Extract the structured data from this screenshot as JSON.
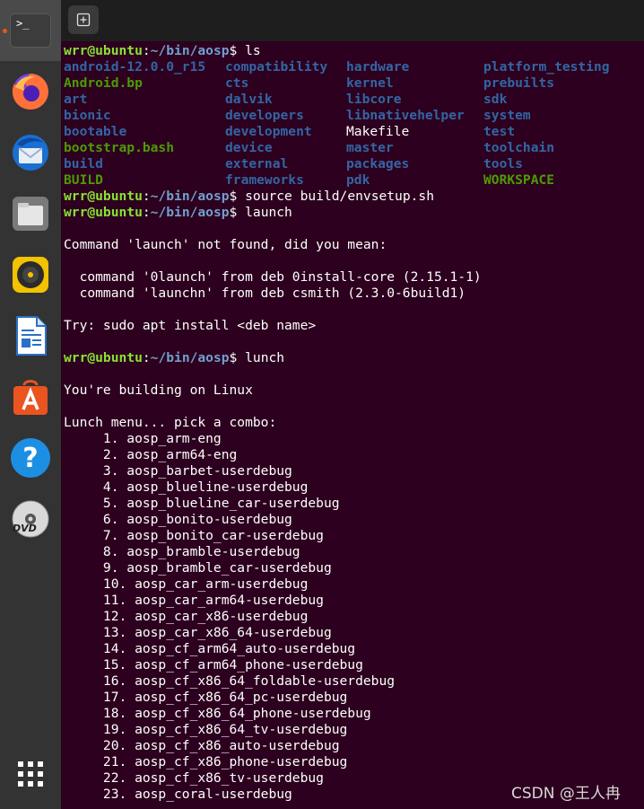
{
  "dock": {
    "items": [
      {
        "name": "terminal",
        "active": true
      },
      {
        "name": "firefox"
      },
      {
        "name": "thunderbird"
      },
      {
        "name": "files"
      },
      {
        "name": "rhythmbox"
      },
      {
        "name": "libreoffice-writer"
      },
      {
        "name": "ubuntu-software"
      },
      {
        "name": "help"
      },
      {
        "name": "dvd"
      },
      {
        "name": "show-applications"
      }
    ],
    "terminal_glyph": ">_",
    "dvd_label": "DVD",
    "help_glyph": "?"
  },
  "tabbar": {
    "new_tab_icon": "new-tab-icon"
  },
  "prompt": {
    "user_host": "wrr@ubuntu",
    "sep": ":",
    "path": "~/bin/aosp",
    "dollar": "$ "
  },
  "commands": {
    "ls": "ls",
    "source": "source build/envsetup.sh",
    "launch": "launch",
    "lunch": "lunch"
  },
  "ls_output": {
    "columns": [
      [
        {
          "name": "android-12.0.0_r15",
          "type": "dir"
        },
        {
          "name": "Android.bp",
          "type": "exe"
        },
        {
          "name": "art",
          "type": "dir"
        },
        {
          "name": "bionic",
          "type": "dir"
        },
        {
          "name": "bootable",
          "type": "dir"
        },
        {
          "name": "bootstrap.bash",
          "type": "exe"
        },
        {
          "name": "build",
          "type": "dir"
        },
        {
          "name": "BUILD",
          "type": "exe"
        }
      ],
      [
        {
          "name": "compatibility",
          "type": "dir"
        },
        {
          "name": "cts",
          "type": "dir"
        },
        {
          "name": "dalvik",
          "type": "dir"
        },
        {
          "name": "developers",
          "type": "dir"
        },
        {
          "name": "development",
          "type": "dir"
        },
        {
          "name": "device",
          "type": "dir"
        },
        {
          "name": "external",
          "type": "dir"
        },
        {
          "name": "frameworks",
          "type": "dir"
        }
      ],
      [
        {
          "name": "hardware",
          "type": "dir"
        },
        {
          "name": "kernel",
          "type": "dir"
        },
        {
          "name": "libcore",
          "type": "dir"
        },
        {
          "name": "libnativehelper",
          "type": "dir"
        },
        {
          "name": "Makefile",
          "type": "plain"
        },
        {
          "name": "master",
          "type": "dir"
        },
        {
          "name": "packages",
          "type": "dir"
        },
        {
          "name": "pdk",
          "type": "dir"
        }
      ],
      [
        {
          "name": "platform_testing",
          "type": "dir"
        },
        {
          "name": "prebuilts",
          "type": "dir"
        },
        {
          "name": "sdk",
          "type": "dir"
        },
        {
          "name": "system",
          "type": "dir"
        },
        {
          "name": "test",
          "type": "dir"
        },
        {
          "name": "toolchain",
          "type": "dir"
        },
        {
          "name": "tools",
          "type": "dir"
        },
        {
          "name": "WORKSPACE",
          "type": "exe"
        }
      ]
    ]
  },
  "launch_output": {
    "not_found": "Command 'launch' not found, did you mean:",
    "suggestions": [
      "  command '0launch' from deb 0install-core (2.15.1-1)",
      "  command 'launchn' from deb csmith (2.3.0-6build1)"
    ],
    "try": "Try: sudo apt install <deb name>"
  },
  "lunch_output": {
    "building_on": "You're building on Linux",
    "menu_header": "Lunch menu... pick a combo:",
    "combos": [
      "     1. aosp_arm-eng",
      "     2. aosp_arm64-eng",
      "     3. aosp_barbet-userdebug",
      "     4. aosp_blueline-userdebug",
      "     5. aosp_blueline_car-userdebug",
      "     6. aosp_bonito-userdebug",
      "     7. aosp_bonito_car-userdebug",
      "     8. aosp_bramble-userdebug",
      "     9. aosp_bramble_car-userdebug",
      "     10. aosp_car_arm-userdebug",
      "     11. aosp_car_arm64-userdebug",
      "     12. aosp_car_x86-userdebug",
      "     13. aosp_car_x86_64-userdebug",
      "     14. aosp_cf_arm64_auto-userdebug",
      "     15. aosp_cf_arm64_phone-userdebug",
      "     16. aosp_cf_x86_64_foldable-userdebug",
      "     17. aosp_cf_x86_64_pc-userdebug",
      "     18. aosp_cf_x86_64_phone-userdebug",
      "     19. aosp_cf_x86_64_tv-userdebug",
      "     20. aosp_cf_x86_auto-userdebug",
      "     21. aosp_cf_x86_phone-userdebug",
      "     22. aosp_cf_x86_tv-userdebug",
      "     23. aosp_coral-userdebug"
    ]
  },
  "watermark": "CSDN @王人冉",
  "colors": {
    "terminal_bg": "#2c001e",
    "prompt_user": "#8ae234",
    "prompt_path": "#729fcf",
    "dir": "#3465a4",
    "exe": "#4e9a06"
  }
}
